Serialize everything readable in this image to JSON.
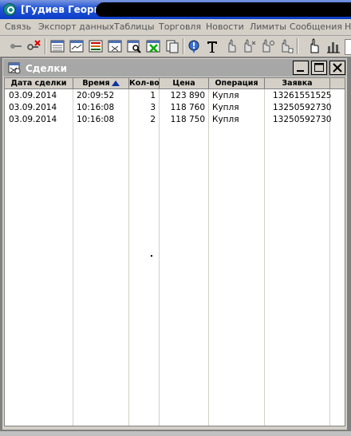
{
  "app": {
    "title": "[Гудиев Георгий"
  },
  "menu": [
    {
      "label": "Связь"
    },
    {
      "label": "Экспорт данных"
    },
    {
      "label": "Таблицы"
    },
    {
      "label": "Торговля"
    },
    {
      "label": "Новости"
    },
    {
      "label": "Лимиты"
    },
    {
      "label": "Сообщения"
    },
    {
      "label": "Н"
    }
  ],
  "toolbar": {
    "buttons": [
      "connect-icon",
      "disconnect-icon",
      "table-icon",
      "chart-icon",
      "list-icon",
      "order-icon",
      "find-icon",
      "cancel-order-icon",
      "copy-icon",
      "alert-icon",
      "text-icon",
      "hand-buy-icon",
      "hand-sell-icon",
      "hand-icon",
      "hand-stop-icon",
      "hand-point-icon",
      "bar-chart-icon"
    ]
  },
  "window": {
    "title": "Сделки",
    "columns": [
      "Дата сделки",
      "Время",
      "Кол-во",
      "Цена",
      "Операция",
      "Заявка"
    ],
    "sort_column": "Время",
    "rows": [
      {
        "date": "03.09.2014",
        "time": "20:09:52",
        "qty": "1",
        "price": "123 890",
        "operation": "Купля",
        "order": "13261551525"
      },
      {
        "date": "03.09.2014",
        "time": "10:16:08",
        "qty": "3",
        "price": "118 760",
        "operation": "Купля",
        "order": "13250592730"
      },
      {
        "date": "03.09.2014",
        "time": "10:16:08",
        "qty": "2",
        "price": "118 750",
        "operation": "Купля",
        "order": "13250592730"
      }
    ]
  },
  "colors": {
    "accent": "#0a3cc9",
    "child_title": "#a7a7a7"
  }
}
